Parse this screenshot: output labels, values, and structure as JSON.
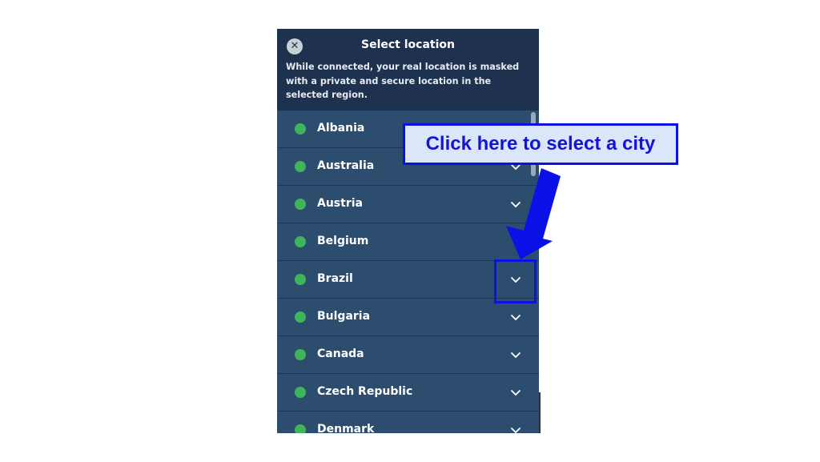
{
  "header": {
    "title": "Select location",
    "description": "While connected, your real location is masked with a private and secure location in the selected region."
  },
  "locations": [
    {
      "name": "Albania",
      "status_color": "#3fb55a",
      "expandable": false
    },
    {
      "name": "Australia",
      "status_color": "#3fb55a",
      "expandable": true
    },
    {
      "name": "Austria",
      "status_color": "#3fb55a",
      "expandable": true
    },
    {
      "name": "Belgium",
      "status_color": "#3fb55a",
      "expandable": false
    },
    {
      "name": "Brazil",
      "status_color": "#3fb55a",
      "expandable": true
    },
    {
      "name": "Bulgaria",
      "status_color": "#3fb55a",
      "expandable": true
    },
    {
      "name": "Canada",
      "status_color": "#3fb55a",
      "expandable": true
    },
    {
      "name": "Czech Republic",
      "status_color": "#3fb55a",
      "expandable": true
    },
    {
      "name": "Denmark",
      "status_color": "#3fb55a",
      "expandable": true
    }
  ],
  "annotation": {
    "callout_text": "Click here to select a city",
    "accent_color": "#0a10e6"
  },
  "icons": {
    "close": "close-icon",
    "expand": "chevron-down-icon",
    "status": "status-dot-icon"
  }
}
